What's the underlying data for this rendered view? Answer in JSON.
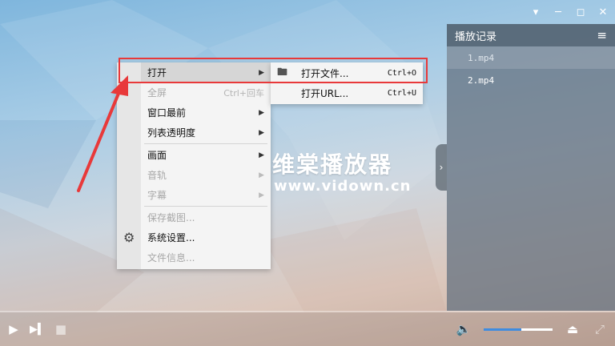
{
  "window": {
    "controls": [
      "minimize-icon",
      "restore-icon",
      "maximize-icon",
      "close-icon"
    ]
  },
  "playlist": {
    "title": "播放记录",
    "items": [
      {
        "label": "1.mp4",
        "selected": true
      },
      {
        "label": "2.mp4",
        "selected": false
      }
    ]
  },
  "watermark": {
    "line1": "维棠播放器",
    "line2": "www.vidown.cn"
  },
  "menu": {
    "items": [
      {
        "label": "打开",
        "has_submenu": true,
        "disabled": false,
        "hover": true
      },
      {
        "label": "全屏",
        "shortcut": "Ctrl+回车",
        "disabled": true
      },
      {
        "label": "窗口最前",
        "has_submenu": true,
        "disabled": false
      },
      {
        "label": "列表透明度",
        "has_submenu": true,
        "disabled": false
      },
      {
        "label": "画面",
        "has_submenu": true,
        "disabled": false
      },
      {
        "label": "音轨",
        "has_submenu": true,
        "disabled": true
      },
      {
        "label": "字幕",
        "has_submenu": true,
        "disabled": true
      },
      {
        "label": "保存截图...",
        "disabled": true
      },
      {
        "label": "系统设置...",
        "disabled": false
      },
      {
        "label": "文件信息...",
        "disabled": true
      }
    ]
  },
  "submenu": {
    "items": [
      {
        "label": "打开文件...",
        "shortcut": "Ctrl+O",
        "icon": "folder-icon"
      },
      {
        "label": "打开URL...",
        "shortcut": "Ctrl+U"
      }
    ]
  },
  "controls": {
    "volume_level": 0.55
  },
  "colors": {
    "highlight": "#e8393a",
    "volume_fill": "#3f8ce0"
  }
}
